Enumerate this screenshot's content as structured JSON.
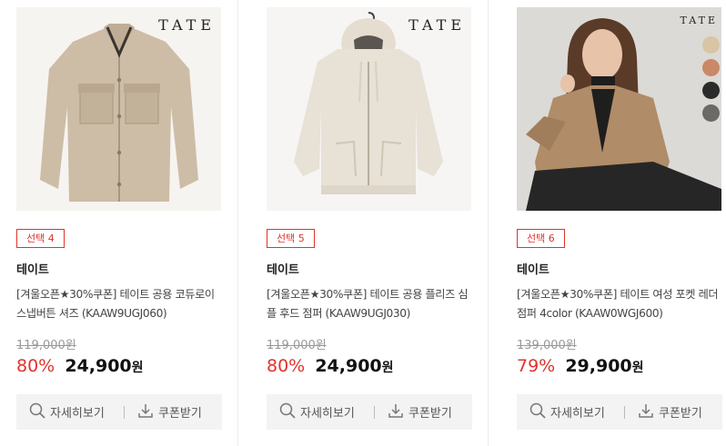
{
  "products": [
    {
      "brand_logo": "TATE",
      "badge": "선택 4",
      "brand": "테이트",
      "title": "[겨울오픈★30%쿠폰] 테이트 공용 코듀로이 스냅버튼 셔즈 (KAAW9UGJ060)",
      "original_price": "119,000원",
      "discount": "80%",
      "price": "24,900",
      "currency": "원",
      "detail_label": "자세히보기",
      "coupon_label": "쿠폰받기"
    },
    {
      "brand_logo": "TATE",
      "badge": "선택 5",
      "brand": "테이트",
      "title": "[겨울오픈★30%쿠폰] 테이트 공용 플리즈 심플 후드 점퍼 (KAAW9UGJ030)",
      "original_price": "119,000원",
      "discount": "80%",
      "price": "24,900",
      "currency": "원",
      "detail_label": "자세히보기",
      "coupon_label": "쿠폰받기"
    },
    {
      "brand_logo": "TATE",
      "badge": "선택 6",
      "brand": "테이트",
      "title": "[겨울오픈★30%쿠폰] 테이트 여성 포켓 레더 점퍼 4color (KAAW0WGJ600)",
      "original_price": "139,000원",
      "discount": "79%",
      "price": "29,900",
      "currency": "원",
      "detail_label": "자세히보기",
      "coupon_label": "쿠폰받기",
      "color_swatches": [
        "#d9c4a4",
        "#c98866",
        "#2b2b2b",
        "#6a6a66"
      ]
    }
  ],
  "colors": {
    "accent_red": "#e0332c",
    "action_bar_bg": "#f3f3f3"
  },
  "icons": {
    "detail": "search-icon",
    "coupon": "download-icon"
  }
}
